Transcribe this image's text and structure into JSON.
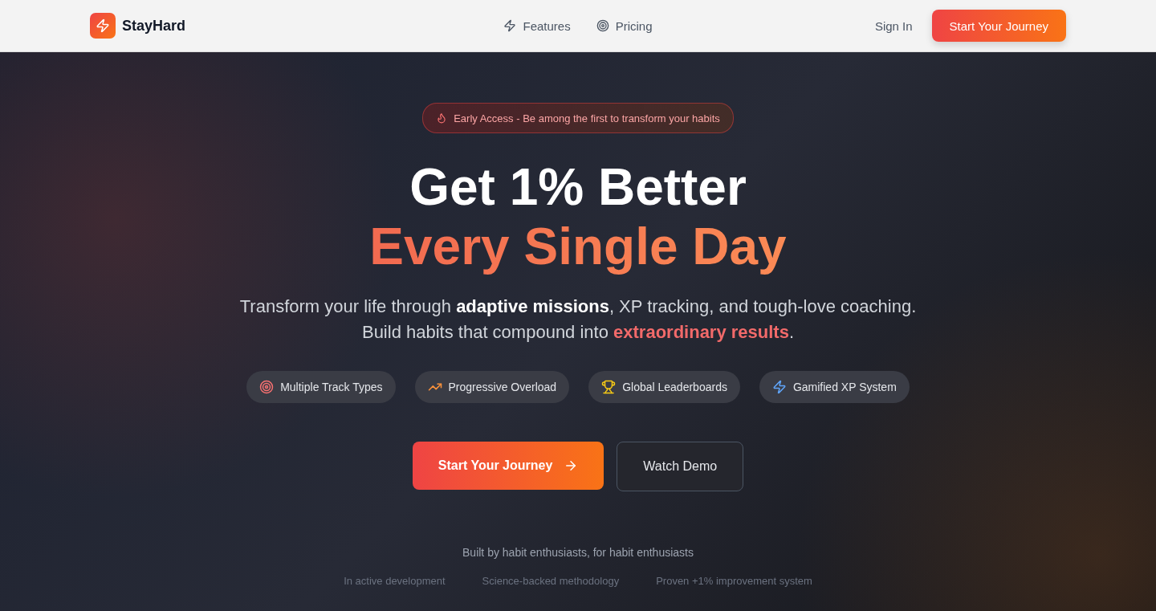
{
  "header": {
    "brand": "StayHard",
    "nav": [
      {
        "label": "Features",
        "kind": "bolt"
      },
      {
        "label": "Pricing",
        "kind": "target"
      }
    ],
    "sign_in": "Sign In",
    "cta": "Start Your Journey"
  },
  "hero": {
    "badge": "Early Access - Be among the first to transform your habits",
    "title_line_1": "Get 1% Better",
    "title_line_2": "Every Single Day",
    "subtitle": "Transform your life through **adaptive missions**, XP tracking, and tough-love coaching. Build habits that compound into **extraordinary results**.",
    "features": [
      {
        "label": "Multiple Track Types",
        "kind": "target",
        "color": "#f87171"
      },
      {
        "label": "Progressive Overload",
        "kind": "trend",
        "color": "#fb923c"
      },
      {
        "label": "Global Leaderboards",
        "kind": "trophy",
        "color": "#facc15"
      },
      {
        "label": "Gamified XP System",
        "kind": "bolt",
        "color": "#60a5fa"
      }
    ],
    "primary_button": "Start Your Journey",
    "secondary_button": "Watch Demo",
    "tagline": "Built by habit enthusiasts, for habit enthusiasts",
    "facts": [
      "In active development",
      "Science-backed methodology",
      "Proven +1% improvement system"
    ]
  }
}
